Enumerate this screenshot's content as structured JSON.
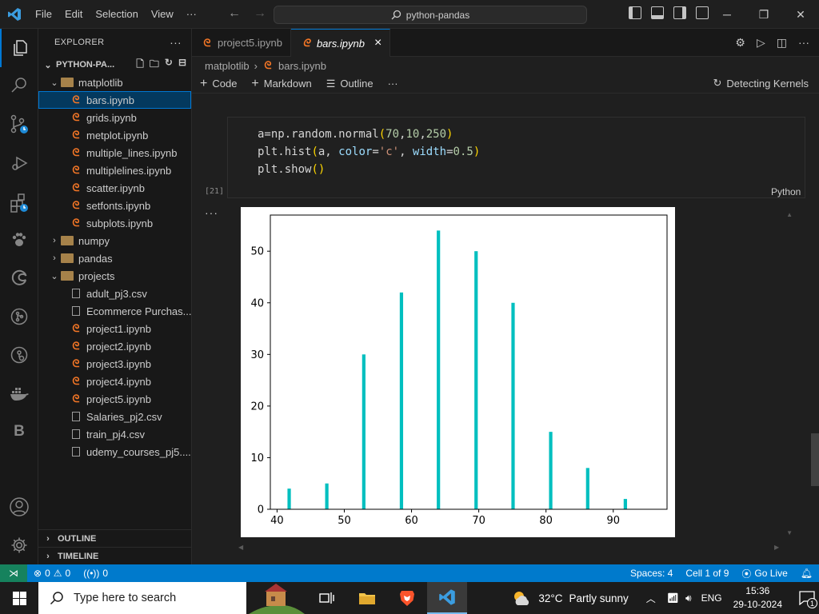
{
  "titlebar": {
    "menu": [
      "File",
      "Edit",
      "Selection",
      "View"
    ],
    "more": "···",
    "search": "python-pandas"
  },
  "sidebar": {
    "title": "EXPLORER",
    "more": "···",
    "root": "PYTHON-PA...",
    "tree": [
      {
        "label": "matplotlib",
        "kind": "folder",
        "open": true,
        "depth": 1
      },
      {
        "label": "bars.ipynb",
        "kind": "notebook",
        "depth": 2,
        "selected": true
      },
      {
        "label": "grids.ipynb",
        "kind": "notebook",
        "depth": 2
      },
      {
        "label": "metplot.ipynb",
        "kind": "notebook",
        "depth": 2
      },
      {
        "label": "multiple_lines.ipynb",
        "kind": "notebook",
        "depth": 2
      },
      {
        "label": "multiplelines.ipynb",
        "kind": "notebook",
        "depth": 2
      },
      {
        "label": "scatter.ipynb",
        "kind": "notebook",
        "depth": 2
      },
      {
        "label": "setfonts.ipynb",
        "kind": "notebook",
        "depth": 2
      },
      {
        "label": "subplots.ipynb",
        "kind": "notebook",
        "depth": 2
      },
      {
        "label": "numpy",
        "kind": "folder",
        "open": false,
        "depth": 1
      },
      {
        "label": "pandas",
        "kind": "folder",
        "open": false,
        "depth": 1
      },
      {
        "label": "projects",
        "kind": "folder",
        "open": true,
        "depth": 1
      },
      {
        "label": "adult_pj3.csv",
        "kind": "csv",
        "depth": 2
      },
      {
        "label": "Ecommerce Purchas...",
        "kind": "csv",
        "depth": 2
      },
      {
        "label": "project1.ipynb",
        "kind": "notebook",
        "depth": 2
      },
      {
        "label": "project2.ipynb",
        "kind": "notebook",
        "depth": 2
      },
      {
        "label": "project3.ipynb",
        "kind": "notebook",
        "depth": 2
      },
      {
        "label": "project4.ipynb",
        "kind": "notebook",
        "depth": 2
      },
      {
        "label": "project5.ipynb",
        "kind": "notebook",
        "depth": 2
      },
      {
        "label": "Salaries_pj2.csv",
        "kind": "csv",
        "depth": 2
      },
      {
        "label": "train_pj4.csv",
        "kind": "csv",
        "depth": 2
      },
      {
        "label": "udemy_courses_pj5....",
        "kind": "csv",
        "depth": 2
      }
    ],
    "outline": "OUTLINE",
    "timeline": "TIMELINE"
  },
  "tabs": [
    {
      "label": "project5.ipynb",
      "active": false
    },
    {
      "label": "bars.ipynb",
      "active": true,
      "close": "×"
    }
  ],
  "breadcrumb": {
    "folder": "matplotlib",
    "file": "bars.ipynb"
  },
  "toolbar": {
    "code": "Code",
    "markdown": "Markdown",
    "outline": "Outline",
    "more": "···",
    "kernel": "Detecting Kernels"
  },
  "cell": {
    "lines": [
      {
        "parts": [
          [
            "",
            "a=np.random.normal"
          ],
          [
            "t-p",
            "("
          ],
          [
            "t-num",
            "70"
          ],
          [
            "",
            ","
          ],
          [
            "t-num",
            "10"
          ],
          [
            "",
            ","
          ],
          [
            "t-num",
            "250"
          ],
          [
            "t-p",
            ")"
          ]
        ]
      },
      {
        "parts": [
          [
            "",
            "plt.hist"
          ],
          [
            "t-p",
            "("
          ],
          [
            "",
            "a, "
          ],
          [
            "t-kw",
            "color"
          ],
          [
            "",
            "="
          ],
          [
            "t-str",
            "'c'"
          ],
          [
            "",
            ", "
          ],
          [
            "t-kw",
            "width"
          ],
          [
            "",
            "="
          ],
          [
            "t-num",
            "0.5"
          ],
          [
            "t-p",
            ")"
          ]
        ]
      },
      {
        "parts": [
          [
            "",
            "plt.show"
          ],
          [
            "t-p",
            "()"
          ]
        ]
      }
    ],
    "exec_count": "[21]",
    "language": "Python",
    "output_dots": "···"
  },
  "chart_data": {
    "type": "bar",
    "x": [
      41.8,
      47.4,
      52.9,
      58.5,
      64.0,
      69.6,
      75.1,
      80.7,
      86.2,
      91.8
    ],
    "values": [
      4,
      5,
      30,
      42,
      54,
      50,
      40,
      15,
      8,
      2
    ],
    "bar_width": 0.5,
    "color": "#00bfbf",
    "xlim": [
      39,
      98
    ],
    "ylim": [
      0,
      57
    ],
    "xticks": [
      40,
      50,
      60,
      70,
      80,
      90
    ],
    "yticks": [
      0,
      10,
      20,
      30,
      40,
      50
    ],
    "title": "",
    "xlabel": "",
    "ylabel": "",
    "grid": false
  },
  "statusbar": {
    "errors": "0",
    "warnings": "0",
    "ports": "0",
    "spaces": "Spaces: 4",
    "cell": "Cell 1 of 9",
    "golive": "Go Live"
  },
  "taskbar": {
    "search": "Type here to search",
    "temp": "32°C",
    "weather": "Partly sunny",
    "lang": "ENG",
    "time": "15:36",
    "date": "29-10-2024",
    "notif": "1"
  }
}
